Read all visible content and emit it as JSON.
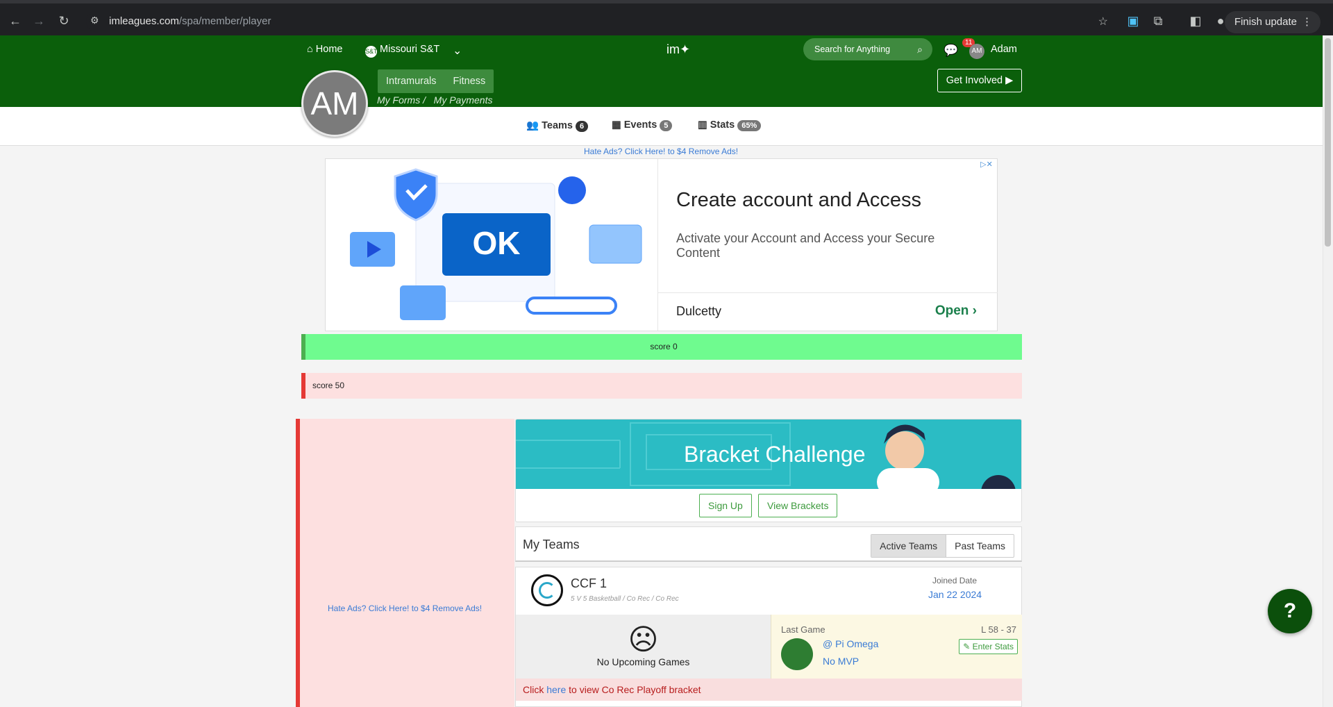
{
  "browser": {
    "url_host": "imleagues.com",
    "url_path": "/spa/member/player",
    "update_label": "Finish update"
  },
  "header": {
    "home": "Home",
    "school": "Missouri S&T",
    "search_placeholder": "Search for Anything",
    "notif_count": "11",
    "user_initials": "AM",
    "user_name": "Adam",
    "avatar_initials": "AM",
    "subtabs": [
      "Intramurals",
      "Fitness"
    ],
    "my_forms": "My Forms /",
    "my_payments": "My Payments",
    "get_involved": "Get Involved ▶"
  },
  "tabs": [
    {
      "label": "Teams",
      "count": "6"
    },
    {
      "label": "Events",
      "count": "5"
    },
    {
      "label": "Stats",
      "count": "65%"
    }
  ],
  "ad_link": "Hate Ads? Click Here! to $4 Remove Ads!",
  "ad": {
    "ok": "OK",
    "headline": "Create account and Access",
    "desc": "Activate your Account and Access your Secure Content",
    "brand": "Dulcetty",
    "open": "Open ›"
  },
  "alerts": {
    "green": "score 0",
    "red": "score 50"
  },
  "side_ad_link": "Hate Ads? Click Here! to $4 Remove Ads!",
  "bracket": {
    "title": "Bracket Challenge",
    "signup": "Sign Up",
    "view": "View Brackets"
  },
  "my_teams": {
    "title": "My Teams",
    "active": "Active Teams",
    "past": "Past Teams"
  },
  "team": {
    "name": "CCF 1",
    "sub": "5 V 5 Basketball / Co Rec / Co Rec",
    "joined_label": "Joined Date",
    "joined_date": "Jan 22 2024",
    "no_games": "No Upcoming Games",
    "last_game_label": "Last Game",
    "score": "L 58 - 37",
    "opponent": "@ Pi Omega",
    "mvp": "No MVP",
    "enter_stats": "✎ Enter Stats",
    "playoff_pre": "Click",
    "playoff_link": "here",
    "playoff_post": "to view Co Rec Playoff bracket"
  },
  "colors": {
    "header_green": "#0b5f0b",
    "alert_green": "#6ffb8f",
    "alert_red": "#fde0e0",
    "link": "#3a7bd5"
  }
}
